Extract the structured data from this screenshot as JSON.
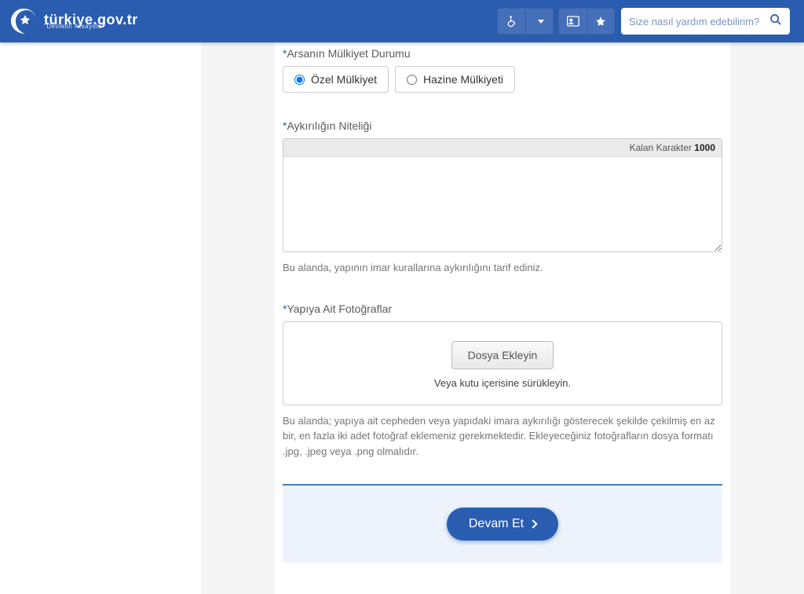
{
  "header": {
    "logo_text": "türkiye.gov.tr",
    "logo_sub": "\"Devletin Kısayolu\"",
    "search_placeholder": "Size nasıl yardım edebilirim?"
  },
  "form": {
    "ownership": {
      "label": "Arsanın Mülkiyet Durumu",
      "options": [
        {
          "value": "ozel",
          "label": "Özel Mülkiyet",
          "selected": true
        },
        {
          "value": "hazine",
          "label": "Hazine Mülkiyeti",
          "selected": false
        }
      ]
    },
    "violation": {
      "label": "Aykırılığın Niteliği",
      "remaining_label": "Kalan Karakter",
      "remaining_count": "1000",
      "value": "",
      "helper": "Bu alanda, yapının imar kurallarına aykırılığını tarif ediniz."
    },
    "photos": {
      "label": "Yapıya Ait Fotoğraflar",
      "button": "Dosya Ekleyin",
      "drag_hint": "Veya kutu içerisine sürükleyin.",
      "helper": "Bu alanda; yapıya ait cepheden veya yapıdaki imara aykırılığı gösterecek şekilde çekilmiş en az bir, en fazla iki adet fotoğraf eklemeniz gerekmektedir. Ekleyeceğiniz fotoğrafların dosya formatı .jpg, .jpeg veya .png olmalıdır."
    },
    "actions": {
      "continue": "Devam Et"
    }
  }
}
